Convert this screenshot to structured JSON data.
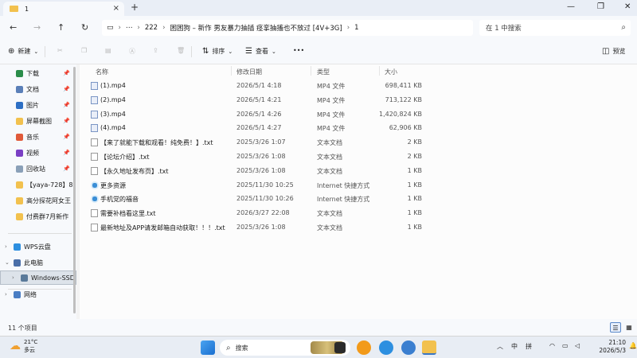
{
  "window": {
    "tab_title": "1",
    "tab_close": "×",
    "newtab": "+",
    "minimize": "—",
    "maximize": "❐",
    "close": "✕"
  },
  "address": {
    "more": "⋯",
    "segments": [
      "222",
      "困困狗 – 新作 男友暴力抽插 痉挛抽搐也不放过 [4V+3G]",
      "1"
    ],
    "search_placeholder": "在 1 中搜索"
  },
  "toolbar": {
    "new_label": "新建",
    "sort_label": "排序",
    "view_label": "查看",
    "more_label": "•••",
    "preview_label": "预览"
  },
  "sidebar": {
    "items": [
      {
        "label": "下载",
        "color": "#2a8c4a",
        "pinned": true
      },
      {
        "label": "文档",
        "color": "#5a7fb8",
        "pinned": true
      },
      {
        "label": "图片",
        "color": "#2d6fc4",
        "pinned": true
      },
      {
        "label": "屏幕截图",
        "color": "#f2c14e",
        "pinned": true
      },
      {
        "label": "音乐",
        "color": "#e05a3a",
        "pinned": true
      },
      {
        "label": "视频",
        "color": "#7a3fc4",
        "pinned": true
      },
      {
        "label": "回收站",
        "color": "#8aa0b8",
        "pinned": true
      },
      {
        "label": "【yaya-728】8.",
        "color": "#f2c14e",
        "pinned": false
      },
      {
        "label": "高分探花阿女王",
        "color": "#f2c14e",
        "pinned": false
      },
      {
        "label": "付费群7月新作",
        "color": "#f2c14e",
        "pinned": false
      }
    ],
    "tree": [
      {
        "label": "WPS云盘",
        "arrow": "›",
        "color": "#2d8fe0"
      },
      {
        "label": "此电脑",
        "arrow": "⌄",
        "color": "#4a6ea8"
      },
      {
        "label": "Windows-SSD",
        "arrow": "›",
        "color": "#5a7a9a"
      },
      {
        "label": "网络",
        "arrow": "›",
        "color": "#4a7ec4"
      }
    ]
  },
  "columns": {
    "name": "名称",
    "date": "修改日期",
    "type": "类型",
    "size": "大小"
  },
  "files": [
    {
      "name": "(1).mp4",
      "date": "2026/5/1 4:18",
      "type": "MP4 文件",
      "size": "698,411 KB",
      "kind": "mp4"
    },
    {
      "name": "(2).mp4",
      "date": "2026/5/1 4:21",
      "type": "MP4 文件",
      "size": "713,122 KB",
      "kind": "mp4"
    },
    {
      "name": "(3).mp4",
      "date": "2026/5/1 4:26",
      "type": "MP4 文件",
      "size": "1,420,824 KB",
      "kind": "mp4"
    },
    {
      "name": "(4).mp4",
      "date": "2026/5/1 4:27",
      "type": "MP4 文件",
      "size": "62,906 KB",
      "kind": "mp4"
    },
    {
      "name": "【来了就能下载和观看！纯免费！】.txt",
      "date": "2025/3/26 1:07",
      "type": "文本文档",
      "size": "2 KB",
      "kind": "txt"
    },
    {
      "name": "【论坛介绍】.txt",
      "date": "2025/3/26 1:08",
      "type": "文本文档",
      "size": "2 KB",
      "kind": "txt"
    },
    {
      "name": "【永久地址发布页】.txt",
      "date": "2025/3/26 1:08",
      "type": "文本文档",
      "size": "1 KB",
      "kind": "txt"
    },
    {
      "name": "更多资源",
      "date": "2025/11/30 10:25",
      "type": "Internet 快捷方式",
      "size": "1 KB",
      "kind": "url"
    },
    {
      "name": "手机党的福音",
      "date": "2025/11/30 10:26",
      "type": "Internet 快捷方式",
      "size": "1 KB",
      "kind": "url"
    },
    {
      "name": "需要补档看这里.txt",
      "date": "2026/3/27 22:08",
      "type": "文本文档",
      "size": "1 KB",
      "kind": "txt"
    },
    {
      "name": "最新地址及APP请发邮箱自动获取！！！.txt",
      "date": "2025/3/26 1:08",
      "type": "文本文档",
      "size": "1 KB",
      "kind": "txt"
    }
  ],
  "status": {
    "count": "11 个项目"
  },
  "taskbar": {
    "temp": "21°C",
    "weather": "多云",
    "search": "搜索",
    "ime1": "中",
    "ime2": "拼",
    "time": "21:10",
    "date": "2026/5/3"
  }
}
